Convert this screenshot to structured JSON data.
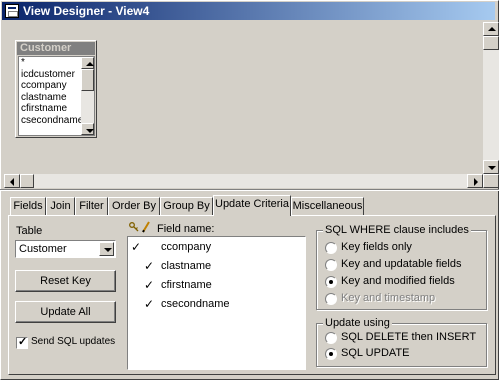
{
  "window": {
    "title": "View Designer - View4"
  },
  "table_box": {
    "title": "Customer",
    "fields": [
      "*",
      "icdcustomer",
      "ccompany",
      "clastname",
      "cfirstname",
      "csecondname"
    ]
  },
  "tabs": [
    {
      "label": "Fields"
    },
    {
      "label": "Join"
    },
    {
      "label": "Filter"
    },
    {
      "label": "Order By"
    },
    {
      "label": "Group By"
    },
    {
      "label": "Update Criteria"
    },
    {
      "label": "Miscellaneous"
    }
  ],
  "active_tab": "Update Criteria",
  "update_criteria": {
    "table_label": "Table",
    "table_value": "Customer",
    "reset_key_label": "Reset Key",
    "update_all_label": "Update All",
    "send_sql_updates_label": "Send SQL updates",
    "send_sql_updates_checked": true,
    "field_name_header": "Field name:",
    "fields": [
      {
        "name": "ccompany",
        "key": true,
        "updatable": false
      },
      {
        "name": "clastname",
        "key": false,
        "updatable": true
      },
      {
        "name": "cfirstname",
        "key": false,
        "updatable": true
      },
      {
        "name": "csecondname",
        "key": false,
        "updatable": true
      }
    ],
    "where_group": {
      "title": "SQL WHERE clause includes",
      "options": [
        {
          "label": "Key fields only",
          "selected": false,
          "enabled": true
        },
        {
          "label": "Key and updatable fields",
          "selected": false,
          "enabled": true
        },
        {
          "label": "Key and modified fields",
          "selected": true,
          "enabled": true
        },
        {
          "label": "Key and timestamp",
          "selected": false,
          "enabled": false
        }
      ]
    },
    "update_group": {
      "title": "Update using",
      "options": [
        {
          "label": "SQL DELETE then INSERT",
          "selected": false
        },
        {
          "label": "SQL UPDATE",
          "selected": true
        }
      ]
    }
  },
  "colors": {
    "titlebar_start": "#0a246a",
    "titlebar_end": "#a6caf0",
    "face": "#d4d0c8"
  }
}
